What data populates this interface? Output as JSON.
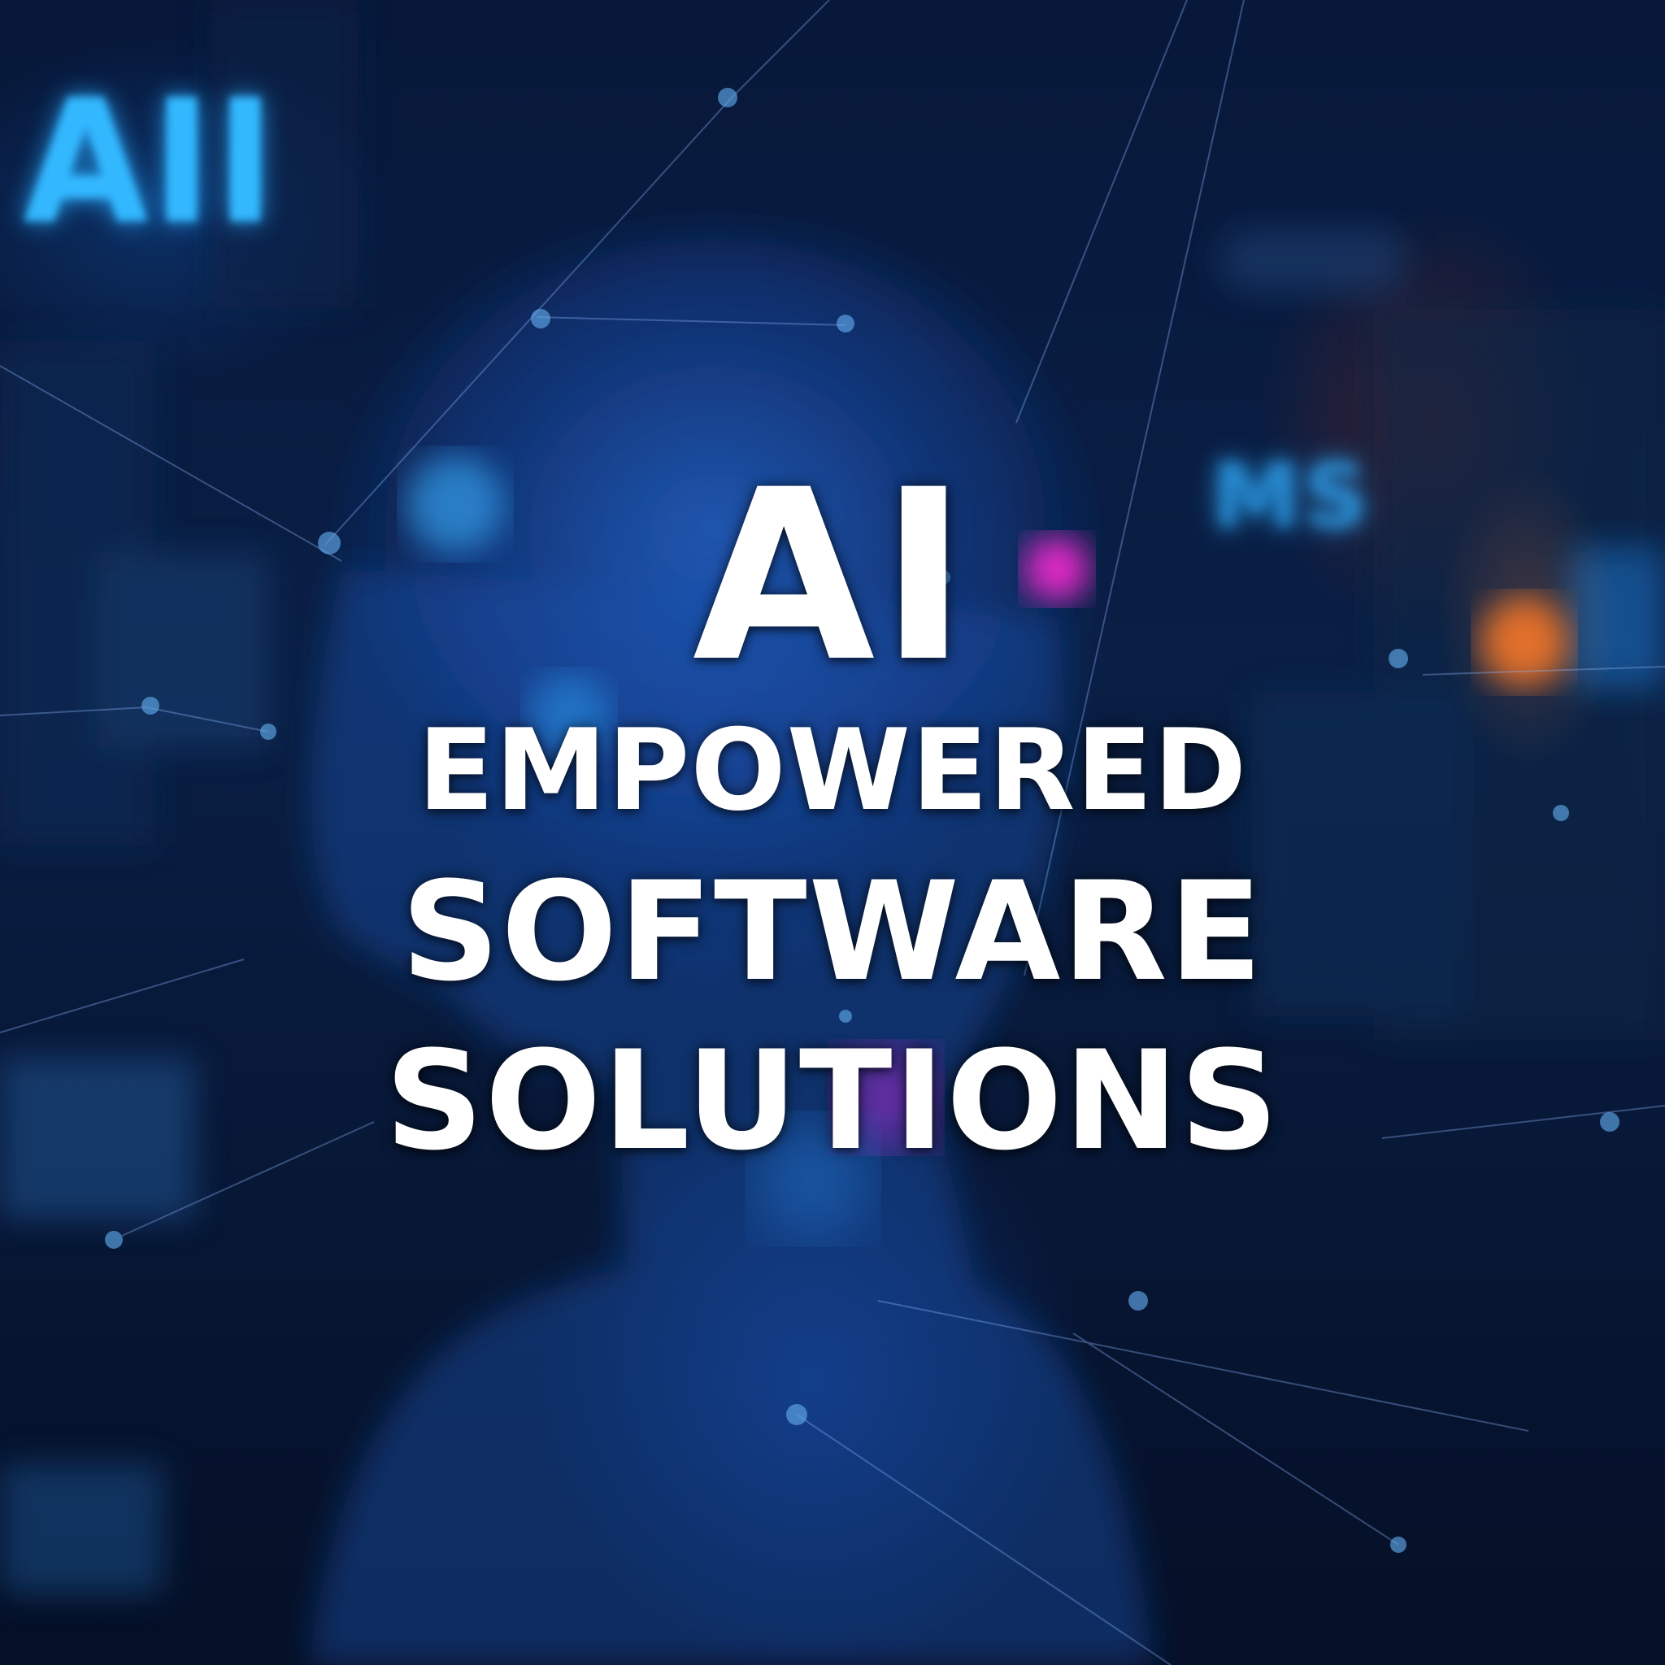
{
  "background": {
    "sign_left_text": "AII",
    "sign_right_text": "MS",
    "colors": {
      "base": "#07183a",
      "glow_blue": "#33b8ff",
      "glow_magenta": "#ff2bd6",
      "glow_orange": "#ff7a28"
    }
  },
  "headline": {
    "line1": "AI",
    "line2": "EMPOWERED",
    "line3": "SOFTWARE",
    "line4": "SOLUTIONS",
    "color": "#ffffff"
  }
}
